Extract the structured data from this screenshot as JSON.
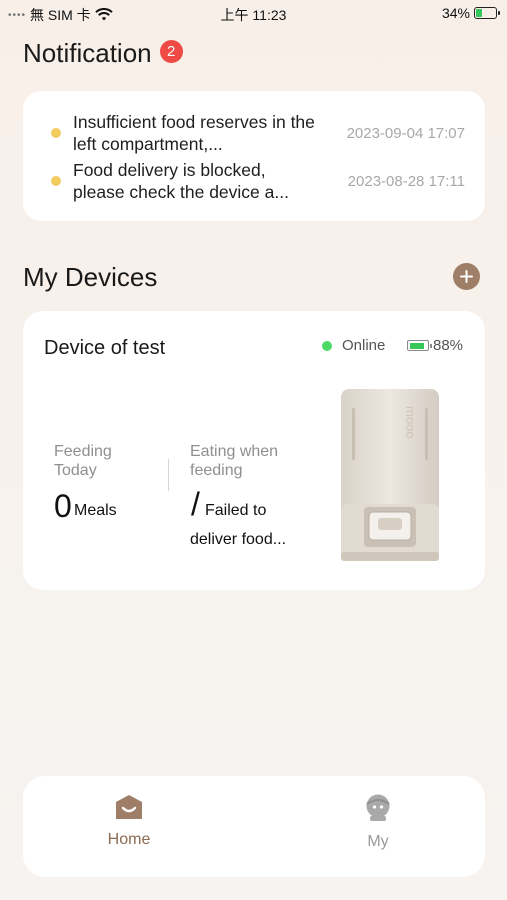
{
  "status_bar": {
    "signal": "••••",
    "carrier": "無 SIM 卡",
    "time": "上午 11:23",
    "battery_pct": "34%",
    "battery_level": 0.34
  },
  "notification": {
    "title": "Notification",
    "badge_count": "2",
    "items": [
      {
        "text": "Insufficient food reserves in the left compartment,...",
        "time": "2023-09-04 17:07"
      },
      {
        "text": "Food delivery is blocked, please check the device a...",
        "time": "2023-08-28 17:11"
      }
    ]
  },
  "devices": {
    "title": "My Devices",
    "add_icon": "plus-icon",
    "device": {
      "name": "Device of test",
      "status": "Online",
      "battery": "88%",
      "battery_level": 0.88,
      "feeding_today_label": "Feeding Today",
      "feeding_today_value": "0",
      "feeding_today_unit": "Meals",
      "eating_label": "Eating when feeding",
      "eating_value": "/",
      "eating_status": "Failed to deliver food..."
    }
  },
  "tab_bar": {
    "tabs": [
      {
        "label": "Home",
        "icon": "home-icon",
        "active": true
      },
      {
        "label": "My",
        "icon": "profile-icon",
        "active": false
      }
    ]
  },
  "colors": {
    "accent": "#8b6a52",
    "badge": "#ef4a44",
    "notif_dot": "#f2cc5f",
    "online": "#4cd964"
  }
}
